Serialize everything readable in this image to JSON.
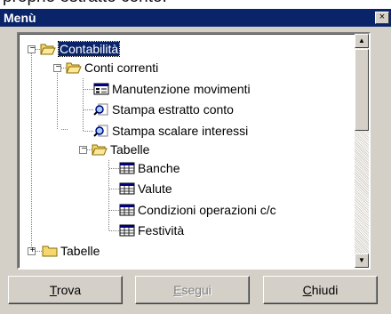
{
  "above_text": "proprio estratto conto.",
  "window": {
    "title": "Menù",
    "close_label": "×"
  },
  "tree": {
    "root": "Contabilità",
    "conti_correnti": "Conti correnti",
    "manutenzione": "Manutenzione movimenti",
    "stampa_estratto": "Stampa estratto conto",
    "stampa_scalare": "Stampa scalare interessi",
    "tabelle_inner": "Tabelle",
    "banche": "Banche",
    "valute": "Valute",
    "condizioni": "Condizioni operazioni c/c",
    "festivita": "Festività",
    "tabelle_outer": "Tabelle"
  },
  "expanders": {
    "minus": "−",
    "plus": "+"
  },
  "scrollbar": {
    "up": "▲",
    "down": "▼"
  },
  "buttons": {
    "trova": {
      "mnemonic": "T",
      "rest": "rova"
    },
    "esegui": {
      "mnemonic": "E",
      "rest": "segui"
    },
    "chiudi": {
      "mnemonic": "C",
      "rest": "hiudi"
    }
  },
  "colors": {
    "title_bg": "#0a246a",
    "face": "#d4d0c8",
    "folder": "#f5d76e",
    "selection": "#0a246a"
  }
}
